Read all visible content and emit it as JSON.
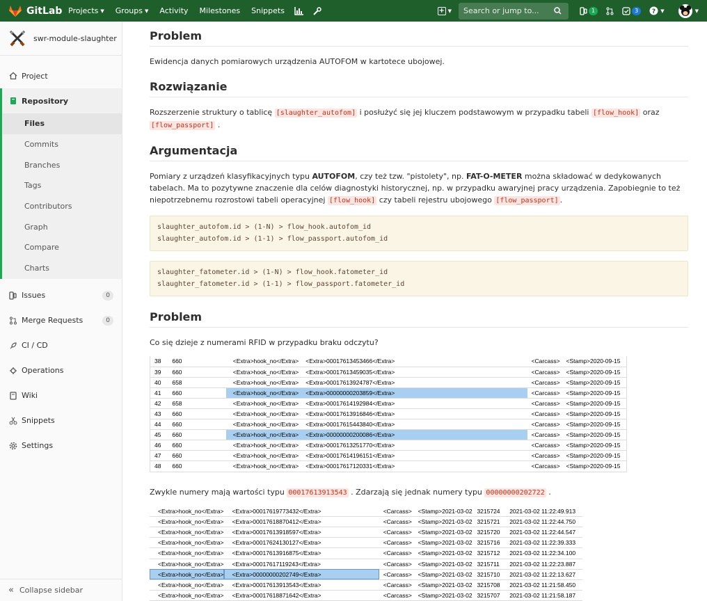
{
  "navbar": {
    "brand": "GitLab",
    "links": [
      "Projects",
      "Groups",
      "Activity",
      "Milestones",
      "Snippets"
    ],
    "search_placeholder": "Search or jump to...",
    "issues_badge": "1",
    "todos_badge": "3"
  },
  "sidebar": {
    "project_name": "swr-module-slaughter",
    "items": {
      "project": "Project",
      "repository": "Repository",
      "issues": "Issues",
      "issues_count": "0",
      "merge_requests": "Merge Requests",
      "merge_requests_count": "0",
      "cicd": "CI / CD",
      "operations": "Operations",
      "wiki": "Wiki",
      "snippets": "Snippets",
      "settings": "Settings"
    },
    "repo_subitems": [
      "Files",
      "Commits",
      "Branches",
      "Tags",
      "Contributors",
      "Graph",
      "Compare",
      "Charts"
    ],
    "collapse": "Collapse sidebar"
  },
  "content": {
    "h_problem1": "Problem",
    "p_problem1": "Ewidencja danych pomiarowych urządzenia AUTOFOM w kartotece ubojowej.",
    "h_solution": "Rozwiązanie",
    "p_solution_a": "Rozszerzenie struktury o tablicę",
    "code_slaughter_autofom": "[slaughter_autofom]",
    "p_solution_b": "i posłużyć się jej kluczem podstawowym w przypadku tabeli",
    "code_flow_hook": "[flow_hook]",
    "p_solution_c": "oraz",
    "code_flow_passport": "[flow_passport]",
    "p_solution_d": ".",
    "h_argument": "Argumentacja",
    "p_arg_1": "Pomiary z urządzeń klasyfikacyjnych typu",
    "p_arg_autofom": "AUTOFOM",
    "p_arg_2": ", czy też tzw. \"pistolety\", np.",
    "p_arg_fatometer": "FAT-O-METER",
    "p_arg_3": "można składować w dedykowanych tabelach. Ma to pozytywne znaczenie dla celów diagnostyki historycznej, np. w przypadku awaryjnej pracy urządzenia. Zapobiegnie to też niepotrzebnemu rozrostowi tabeli operacyjnej",
    "p_arg_4": "czy tabeli rejestru ubojowego",
    "p_arg_5": ".",
    "code_block_1": "slaughter_autofom.id > (1-N) > flow_hook.autofom_id\nslaughter_autofom.id > (1-1) > flow_passport.autofom_id",
    "code_block_2": "slaughter_fatometer.id > (1-N) > flow_hook.fatometer_id\nslaughter_fatometer.id > (1-1) > flow_passport.fatometer_id",
    "h_problem2": "Problem",
    "p_problem2": "Co się dzieje z numerami RFID w przypadku braku odczytu?",
    "p_values_a": "Zwykle numery mają wartości typu",
    "code_val1": "00017613913543",
    "p_values_b": ". Zdarzają się jednak numery typu",
    "code_val2": "00000000202722",
    "p_values_c": "."
  },
  "table1": {
    "rows": [
      {
        "n": "38",
        "w": "660",
        "hook": "<Extra>hook_no</Extra>",
        "extra": "<Extra>00017613453466</Extra>",
        "c": "<Carcass>",
        "s": "<Stamp>2020-09-15",
        "sel": false
      },
      {
        "n": "39",
        "w": "660",
        "hook": "<Extra>hook_no</Extra>",
        "extra": "<Extra>00017613459035</Extra>",
        "c": "<Carcass>",
        "s": "<Stamp>2020-09-15",
        "sel": false
      },
      {
        "n": "40",
        "w": "658",
        "hook": "<Extra>hook_no</Extra>",
        "extra": "<Extra>00017613924787</Extra>",
        "c": "<Carcass>",
        "s": "<Stamp>2020-09-15",
        "sel": false
      },
      {
        "n": "41",
        "w": "660",
        "hook": "<Extra>hook_no</Extra>",
        "extra": "<Extra>00000000203859</Extra>",
        "c": "<Carcass>",
        "s": "<Stamp>2020-09-15",
        "sel": true
      },
      {
        "n": "42",
        "w": "658",
        "hook": "<Extra>hook_no</Extra>",
        "extra": "<Extra>00017614192984</Extra>",
        "c": "<Carcass>",
        "s": "<Stamp>2020-09-15",
        "sel": false
      },
      {
        "n": "43",
        "w": "660",
        "hook": "<Extra>hook_no</Extra>",
        "extra": "<Extra>00017613916846</Extra>",
        "c": "<Carcass>",
        "s": "<Stamp>2020-09-15",
        "sel": false
      },
      {
        "n": "44",
        "w": "660",
        "hook": "<Extra>hook_no</Extra>",
        "extra": "<Extra>00017615443840</Extra>",
        "c": "<Carcass>",
        "s": "<Stamp>2020-09-15",
        "sel": false
      },
      {
        "n": "45",
        "w": "660",
        "hook": "<Extra>hook_no</Extra>",
        "extra": "<Extra>00000000200086</Extra>",
        "c": "<Carcass>",
        "s": "<Stamp>2020-09-15",
        "sel": true
      },
      {
        "n": "46",
        "w": "660",
        "hook": "<Extra>hook_no</Extra>",
        "extra": "<Extra>00017613251770</Extra>",
        "c": "<Carcass>",
        "s": "<Stamp>2020-09-15",
        "sel": false
      },
      {
        "n": "47",
        "w": "660",
        "hook": "<Extra>hook_no</Extra>",
        "extra": "<Extra>00017614196151</Extra>",
        "c": "<Carcass>",
        "s": "<Stamp>2020-09-15",
        "sel": false
      },
      {
        "n": "48",
        "w": "660",
        "hook": "<Extra>hook_no</Extra>",
        "extra": "<Extra>00017617120331</Extra>",
        "c": "<Carcass>",
        "s": "<Stamp>2020-09-15",
        "sel": false
      }
    ]
  },
  "table2": {
    "rows": [
      {
        "hook": "<Extra>hook_no</Extra>",
        "extra": "<Extra>00017619773432</Extra>",
        "c": "<Carcass>",
        "s": "<Stamp>2021-03-02",
        "id": "3215724",
        "ts": "2021-03-02 11:22:49.913",
        "sel": false
      },
      {
        "hook": "<Extra>hook_no</Extra>",
        "extra": "<Extra>00017618870412</Extra>",
        "c": "<Carcass>",
        "s": "<Stamp>2021-03-02",
        "id": "3215721",
        "ts": "2021-03-02 11:22:44.750",
        "sel": false
      },
      {
        "hook": "<Extra>hook_no</Extra>",
        "extra": "<Extra>00017613918597</Extra>",
        "c": "<Carcass>",
        "s": "<Stamp>2021-03-02",
        "id": "3215720",
        "ts": "2021-03-02 11:22:44.547",
        "sel": false
      },
      {
        "hook": "<Extra>hook_no</Extra>",
        "extra": "<Extra>00017624130127</Extra>",
        "c": "<Carcass>",
        "s": "<Stamp>2021-03-02",
        "id": "3215716",
        "ts": "2021-03-02 11:22:39.333",
        "sel": false
      },
      {
        "hook": "<Extra>hook_no</Extra>",
        "extra": "<Extra>00017613916875</Extra>",
        "c": "<Carcass>",
        "s": "<Stamp>2021-03-02",
        "id": "3215712",
        "ts": "2021-03-02 11:22:34.100",
        "sel": false
      },
      {
        "hook": "<Extra>hook_no</Extra>",
        "extra": "<Extra>00017617119243</Extra>",
        "c": "<Carcass>",
        "s": "<Stamp>2021-03-02",
        "id": "3215711",
        "ts": "2021-03-02 11:22:23.887",
        "sel": false
      },
      {
        "hook": "<Extra>hook_no</Extra>",
        "extra": "<Extra>00000000202749</Extra>",
        "c": "<Carcass>",
        "s": "<Stamp>2021-03-02",
        "id": "3215710",
        "ts": "2021-03-02 11:22:13.627",
        "sel": true
      },
      {
        "hook": "<Extra>hook_no</Extra>",
        "extra": "<Extra>00017613913543</Extra>",
        "c": "<Carcass>",
        "s": "<Stamp>2021-03-02",
        "id": "3215708",
        "ts": "2021-03-02 11:21:58.450",
        "sel": false
      },
      {
        "hook": "<Extra>hook_no</Extra>",
        "extra": "<Extra>00017618871642</Extra>",
        "c": "<Carcass>",
        "s": "<Stamp>2021-03-02",
        "id": "3215707",
        "ts": "2021-03-02 11:21:58.187",
        "sel": false
      }
    ]
  },
  "colors": {
    "navbar": "#1f5f2c",
    "accent": "#1aaa55",
    "inline_code_text": "#c0341d",
    "inline_code_bg": "#fbe5e1",
    "code_block_bg": "#fbf5e6",
    "row_selected": "#a8cff0"
  },
  "icons": {
    "brand": "gitlab-tanuki-icon",
    "nav": [
      "chart-icon",
      "wrench-icon",
      "plus-square-icon",
      "search-icon",
      "issues-icon",
      "merge-request-icon",
      "todo-check-icon",
      "help-icon",
      "user-avatar"
    ],
    "sidebar": [
      "home-icon",
      "book-icon",
      "issues-icon",
      "merge-request-icon",
      "rocket-icon",
      "cloud-icon",
      "wiki-icon",
      "scissors-icon",
      "gear-icon",
      "collapse-icon"
    ]
  }
}
